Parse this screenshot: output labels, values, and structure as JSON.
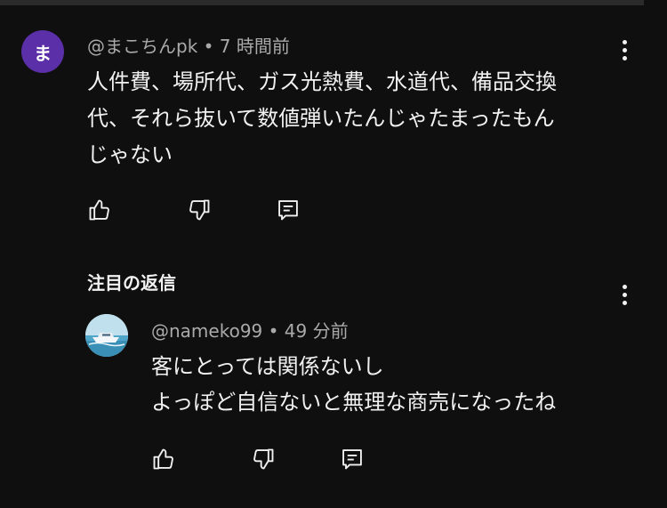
{
  "comment": {
    "avatar_initial": "ま",
    "avatar_color": "#5b2fa8",
    "author": "@まこちんpk",
    "separator": "•",
    "time": "7 時間前",
    "text_lines": [
      "人件費、場所代、ガス光熱費、水道代、備品交換",
      "代、それら抜いて数値弾いたんじゃたまったもん",
      "じゃない"
    ],
    "actions": {
      "like_icon": "thumbs-up-icon",
      "dislike_icon": "thumbs-down-icon",
      "reply_icon": "reply-icon"
    }
  },
  "replies_section": {
    "title": "注目の返信",
    "reply": {
      "author": "@nameko99",
      "separator": "•",
      "time": "49 分前",
      "text_lines": [
        "客にとっては関係ないし",
        "よっぽど自信ないと無理な商売になったね"
      ]
    }
  },
  "colors": {
    "background": "#0f0f0f",
    "text": "#f1f1f1",
    "meta": "#aaaaaa"
  }
}
